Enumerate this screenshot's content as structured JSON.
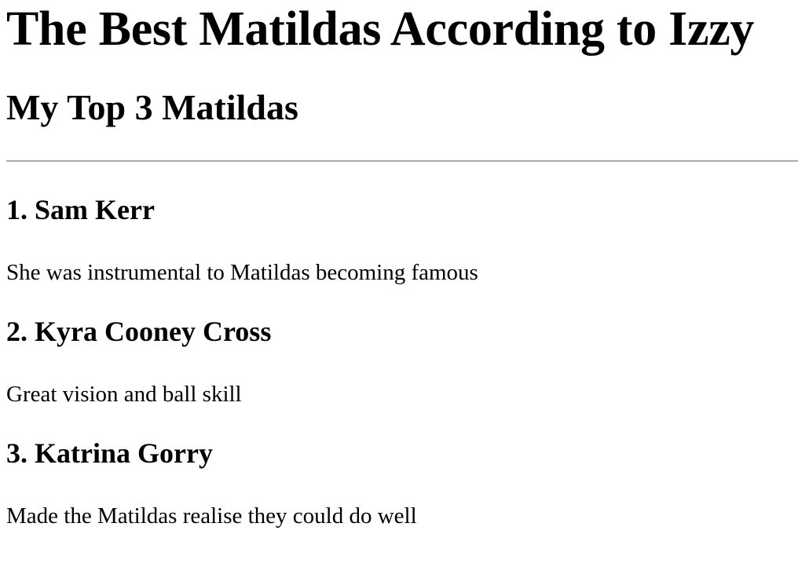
{
  "page": {
    "title": "The Best Matildas According to Izzy",
    "subtitle": "My Top 3 Matildas"
  },
  "list": {
    "items": [
      {
        "rank": "1.",
        "name": "Sam Kerr",
        "description": "She was instrumental to Matildas becoming famous"
      },
      {
        "rank": "2.",
        "name": "Kyra Cooney Cross",
        "description": "Great vision and ball skill"
      },
      {
        "rank": "3.",
        "name": "Katrina Gorry",
        "description": "Made the Matildas realise they could do well"
      }
    ]
  }
}
